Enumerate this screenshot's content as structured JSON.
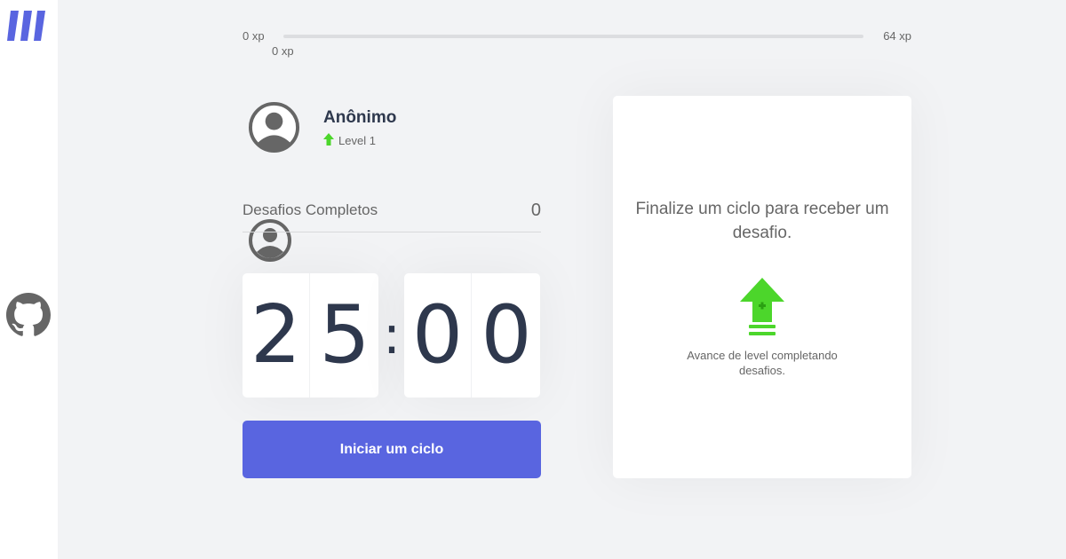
{
  "sidebar": {
    "logo_icon": "move-it-logo-icon",
    "items": [
      {
        "icon": "user-circle-icon"
      },
      {
        "icon": "github-icon"
      }
    ]
  },
  "xp": {
    "start_label": "0 xp",
    "end_label": "64 xp",
    "current_label": "0 xp",
    "progress": 0
  },
  "profile": {
    "name": "Anônimo",
    "level_label": "Level 1",
    "level_icon": "level-up-arrow-icon"
  },
  "completed": {
    "label": "Desafios Completos",
    "count": "0"
  },
  "countdown": {
    "minute_left": "2",
    "minute_right": "5",
    "separator": ":",
    "second_left": "0",
    "second_right": "0"
  },
  "start_button": {
    "label": "Iniciar um ciclo"
  },
  "challenge": {
    "title": "Finalize um ciclo para receber um desafio.",
    "hint": "Avance de level completando desafios.",
    "icon": "level-up-icon"
  },
  "colors": {
    "background": "#f2f3f5",
    "accent_blue": "#5965e0",
    "accent_green": "#4cd62b",
    "title_dark": "#2e384d",
    "text": "#666666"
  }
}
